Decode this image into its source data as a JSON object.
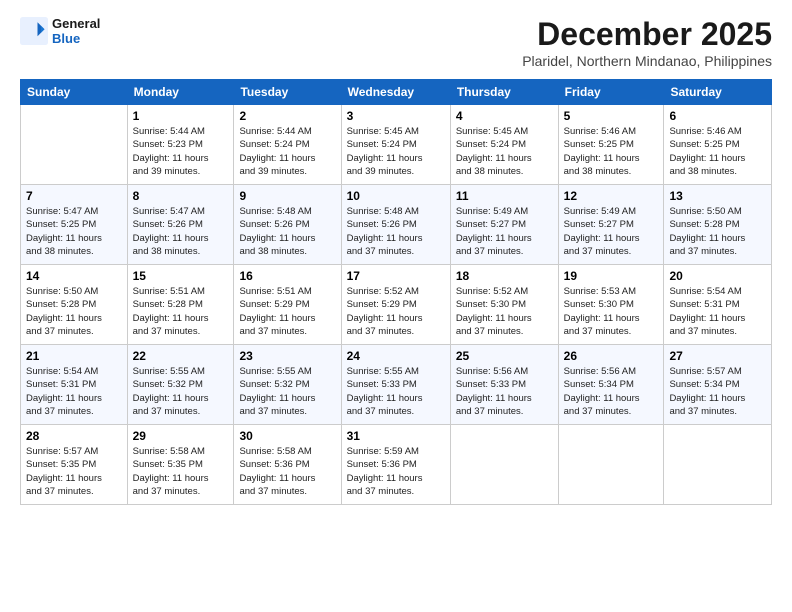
{
  "header": {
    "logo_line1": "General",
    "logo_line2": "Blue",
    "month": "December 2025",
    "location": "Plaridel, Northern Mindanao, Philippines"
  },
  "days_of_week": [
    "Sunday",
    "Monday",
    "Tuesday",
    "Wednesday",
    "Thursday",
    "Friday",
    "Saturday"
  ],
  "weeks": [
    [
      {
        "day": "",
        "info": ""
      },
      {
        "day": "1",
        "info": "Sunrise: 5:44 AM\nSunset: 5:23 PM\nDaylight: 11 hours\nand 39 minutes."
      },
      {
        "day": "2",
        "info": "Sunrise: 5:44 AM\nSunset: 5:24 PM\nDaylight: 11 hours\nand 39 minutes."
      },
      {
        "day": "3",
        "info": "Sunrise: 5:45 AM\nSunset: 5:24 PM\nDaylight: 11 hours\nand 39 minutes."
      },
      {
        "day": "4",
        "info": "Sunrise: 5:45 AM\nSunset: 5:24 PM\nDaylight: 11 hours\nand 38 minutes."
      },
      {
        "day": "5",
        "info": "Sunrise: 5:46 AM\nSunset: 5:25 PM\nDaylight: 11 hours\nand 38 minutes."
      },
      {
        "day": "6",
        "info": "Sunrise: 5:46 AM\nSunset: 5:25 PM\nDaylight: 11 hours\nand 38 minutes."
      }
    ],
    [
      {
        "day": "7",
        "info": "Sunrise: 5:47 AM\nSunset: 5:25 PM\nDaylight: 11 hours\nand 38 minutes."
      },
      {
        "day": "8",
        "info": "Sunrise: 5:47 AM\nSunset: 5:26 PM\nDaylight: 11 hours\nand 38 minutes."
      },
      {
        "day": "9",
        "info": "Sunrise: 5:48 AM\nSunset: 5:26 PM\nDaylight: 11 hours\nand 38 minutes."
      },
      {
        "day": "10",
        "info": "Sunrise: 5:48 AM\nSunset: 5:26 PM\nDaylight: 11 hours\nand 37 minutes."
      },
      {
        "day": "11",
        "info": "Sunrise: 5:49 AM\nSunset: 5:27 PM\nDaylight: 11 hours\nand 37 minutes."
      },
      {
        "day": "12",
        "info": "Sunrise: 5:49 AM\nSunset: 5:27 PM\nDaylight: 11 hours\nand 37 minutes."
      },
      {
        "day": "13",
        "info": "Sunrise: 5:50 AM\nSunset: 5:28 PM\nDaylight: 11 hours\nand 37 minutes."
      }
    ],
    [
      {
        "day": "14",
        "info": "Sunrise: 5:50 AM\nSunset: 5:28 PM\nDaylight: 11 hours\nand 37 minutes."
      },
      {
        "day": "15",
        "info": "Sunrise: 5:51 AM\nSunset: 5:28 PM\nDaylight: 11 hours\nand 37 minutes."
      },
      {
        "day": "16",
        "info": "Sunrise: 5:51 AM\nSunset: 5:29 PM\nDaylight: 11 hours\nand 37 minutes."
      },
      {
        "day": "17",
        "info": "Sunrise: 5:52 AM\nSunset: 5:29 PM\nDaylight: 11 hours\nand 37 minutes."
      },
      {
        "day": "18",
        "info": "Sunrise: 5:52 AM\nSunset: 5:30 PM\nDaylight: 11 hours\nand 37 minutes."
      },
      {
        "day": "19",
        "info": "Sunrise: 5:53 AM\nSunset: 5:30 PM\nDaylight: 11 hours\nand 37 minutes."
      },
      {
        "day": "20",
        "info": "Sunrise: 5:54 AM\nSunset: 5:31 PM\nDaylight: 11 hours\nand 37 minutes."
      }
    ],
    [
      {
        "day": "21",
        "info": "Sunrise: 5:54 AM\nSunset: 5:31 PM\nDaylight: 11 hours\nand 37 minutes."
      },
      {
        "day": "22",
        "info": "Sunrise: 5:55 AM\nSunset: 5:32 PM\nDaylight: 11 hours\nand 37 minutes."
      },
      {
        "day": "23",
        "info": "Sunrise: 5:55 AM\nSunset: 5:32 PM\nDaylight: 11 hours\nand 37 minutes."
      },
      {
        "day": "24",
        "info": "Sunrise: 5:55 AM\nSunset: 5:33 PM\nDaylight: 11 hours\nand 37 minutes."
      },
      {
        "day": "25",
        "info": "Sunrise: 5:56 AM\nSunset: 5:33 PM\nDaylight: 11 hours\nand 37 minutes."
      },
      {
        "day": "26",
        "info": "Sunrise: 5:56 AM\nSunset: 5:34 PM\nDaylight: 11 hours\nand 37 minutes."
      },
      {
        "day": "27",
        "info": "Sunrise: 5:57 AM\nSunset: 5:34 PM\nDaylight: 11 hours\nand 37 minutes."
      }
    ],
    [
      {
        "day": "28",
        "info": "Sunrise: 5:57 AM\nSunset: 5:35 PM\nDaylight: 11 hours\nand 37 minutes."
      },
      {
        "day": "29",
        "info": "Sunrise: 5:58 AM\nSunset: 5:35 PM\nDaylight: 11 hours\nand 37 minutes."
      },
      {
        "day": "30",
        "info": "Sunrise: 5:58 AM\nSunset: 5:36 PM\nDaylight: 11 hours\nand 37 minutes."
      },
      {
        "day": "31",
        "info": "Sunrise: 5:59 AM\nSunset: 5:36 PM\nDaylight: 11 hours\nand 37 minutes."
      },
      {
        "day": "",
        "info": ""
      },
      {
        "day": "",
        "info": ""
      },
      {
        "day": "",
        "info": ""
      }
    ]
  ]
}
